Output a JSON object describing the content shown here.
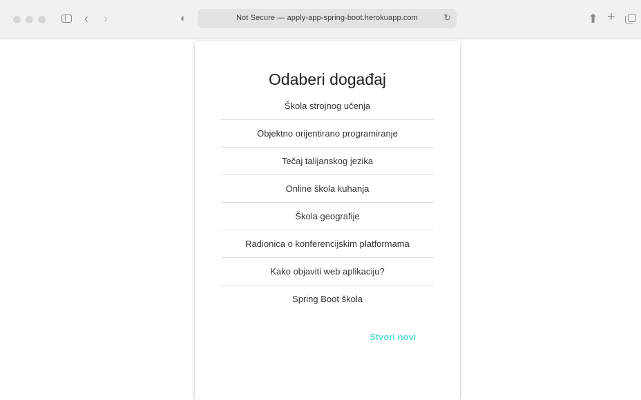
{
  "browser": {
    "address": "Not Secure — apply-app-spring-boot.herokuapp.com",
    "icons": [
      "sidebar-icon",
      "back-icon",
      "forward-icon",
      "shield-icon",
      "reload-icon",
      "share-icon",
      "new-tab-icon",
      "tab-overview-icon"
    ]
  },
  "page": {
    "title": "Odaberi događaj",
    "events": [
      "Škola strojnog učenja",
      "Objektno orijentirano programiranje",
      "Tečaj talijanskog jezika",
      "Online škola kuhanja",
      "Škola geografije",
      "Radionica o konferencijskim platformama",
      "Kako objaviti web aplikaciju?",
      "Spring Boot škola"
    ],
    "create_label": "Stvori novi"
  },
  "colors": {
    "accent": "#5fdcd2"
  }
}
